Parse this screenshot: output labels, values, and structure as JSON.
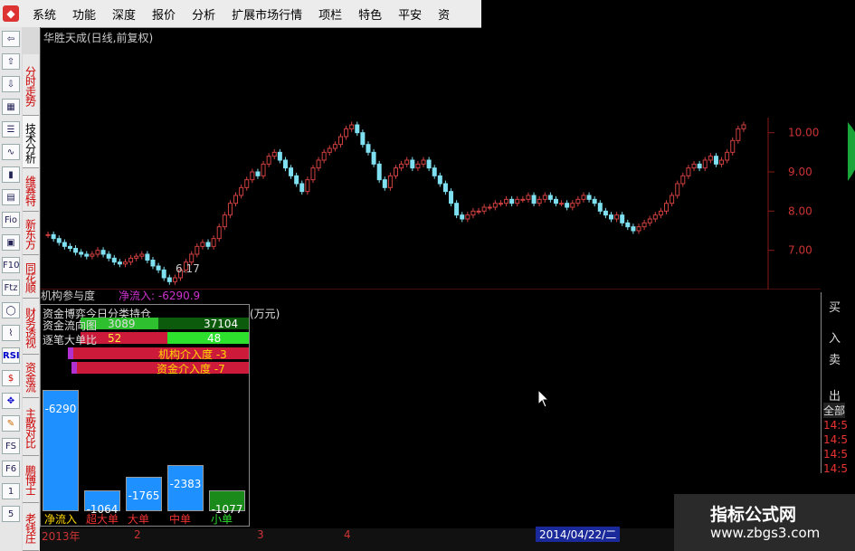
{
  "menu": {
    "items": [
      "系统",
      "功能",
      "深度",
      "报价",
      "分析",
      "扩展市场行情",
      "项栏",
      "特色",
      "平安",
      "资"
    ]
  },
  "toolbar": {
    "icons": [
      "back-arrow-icon",
      "up-arrow-icon",
      "down-arrow-icon",
      "grid-icon",
      "list-icon",
      "kline-icon",
      "candle-icon",
      "building-icon",
      "Fio",
      "report-icon",
      "F10",
      "Ftz",
      "circle-icon",
      "chart-icon",
      "RSI",
      "s-icon",
      "move-icon",
      "pencil-icon",
      "FS",
      "F6",
      "1",
      "5"
    ]
  },
  "sidetabs": [
    "分时走势",
    "技术分析",
    "维赛特",
    "新东方",
    "同花顺",
    "财务透视",
    "资金流",
    "主散对比",
    "鹏博士",
    "老钱庄"
  ],
  "chart": {
    "title": "华胜天成(日线,前复权)",
    "ylabels": [
      "10.00",
      "9.00",
      "8.00",
      "7.00"
    ],
    "low_label": "6.17",
    "date_label": "2014/04/22/二",
    "xlabels": [
      "2013年",
      "2",
      "3",
      "4"
    ]
  },
  "chart_data": {
    "type": "candlestick",
    "title": "华胜天成(日线,前复权)",
    "ylim": [
      6.0,
      10.5
    ],
    "y_ticks": [
      7,
      8,
      9,
      10
    ],
    "closes": [
      7.4,
      7.3,
      7.2,
      7.1,
      7.05,
      6.95,
      6.9,
      6.85,
      6.9,
      7.0,
      6.9,
      6.8,
      6.7,
      6.65,
      6.7,
      6.8,
      6.85,
      6.9,
      6.75,
      6.6,
      6.5,
      6.3,
      6.2,
      6.3,
      6.5,
      6.7,
      6.9,
      7.1,
      7.2,
      7.1,
      7.3,
      7.6,
      7.9,
      8.2,
      8.4,
      8.6,
      8.8,
      9.0,
      8.9,
      9.2,
      9.4,
      9.5,
      9.3,
      9.1,
      8.9,
      8.7,
      8.5,
      8.8,
      9.1,
      9.3,
      9.5,
      9.6,
      9.7,
      9.9,
      10.1,
      10.2,
      10.0,
      9.7,
      9.5,
      9.2,
      8.8,
      8.6,
      8.9,
      9.1,
      9.2,
      9.3,
      9.1,
      9.2,
      9.3,
      9.1,
      8.9,
      8.7,
      8.5,
      8.2,
      7.9,
      7.8,
      7.9,
      8.0,
      8.0,
      8.1,
      8.1,
      8.2,
      8.2,
      8.3,
      8.2,
      8.3,
      8.3,
      8.4,
      8.2,
      8.3,
      8.4,
      8.3,
      8.2,
      8.2,
      8.1,
      8.2,
      8.3,
      8.4,
      8.3,
      8.2,
      8.0,
      7.9,
      7.8,
      7.9,
      7.7,
      7.6,
      7.5,
      7.6,
      7.7,
      7.8,
      7.9,
      8.0,
      8.2,
      8.4,
      8.7,
      8.9,
      9.1,
      9.2,
      9.1,
      9.3,
      9.4,
      9.2,
      9.3,
      9.5,
      9.8,
      10.1,
      10.2
    ]
  },
  "funds": {
    "panel_title": "机构参与度",
    "net_inflow": "净流入: -6290.9",
    "unit": "单位(万元)",
    "row1_label": "资金博弈今日分类持仓",
    "row2_label": "资金流向图",
    "row2_left": "3089",
    "row2_right": "37104",
    "row3_label": "逐笔大单比",
    "row3_left": "52",
    "row3_right": "48",
    "inst": "机构介入度 -3",
    "fund": "资金介入度 -7",
    "bars": [
      {
        "label": "-6290",
        "cat": "净流入",
        "value": -6290,
        "color": "#1e90ff"
      },
      {
        "label": "-1064",
        "cat": "超大单",
        "value": -1064,
        "color": "#1e90ff"
      },
      {
        "label": "-1765",
        "cat": "大单",
        "value": -1765,
        "color": "#1e90ff"
      },
      {
        "label": "-2383",
        "cat": "中单",
        "value": -2383,
        "color": "#1e90ff"
      },
      {
        "label": "-1077",
        "cat": "小单",
        "value": -1077,
        "color": "#1a8a1a"
      }
    ]
  },
  "rightpanel": {
    "buy": "买",
    "in": "入",
    "sell": "卖",
    "out": "出",
    "all": "全部",
    "times": [
      "14:5",
      "14:5",
      "14:5",
      "14:5",
      "14:5"
    ]
  },
  "watermark": {
    "line1": "指标公式网",
    "line2": "www.zbgs3.com"
  }
}
